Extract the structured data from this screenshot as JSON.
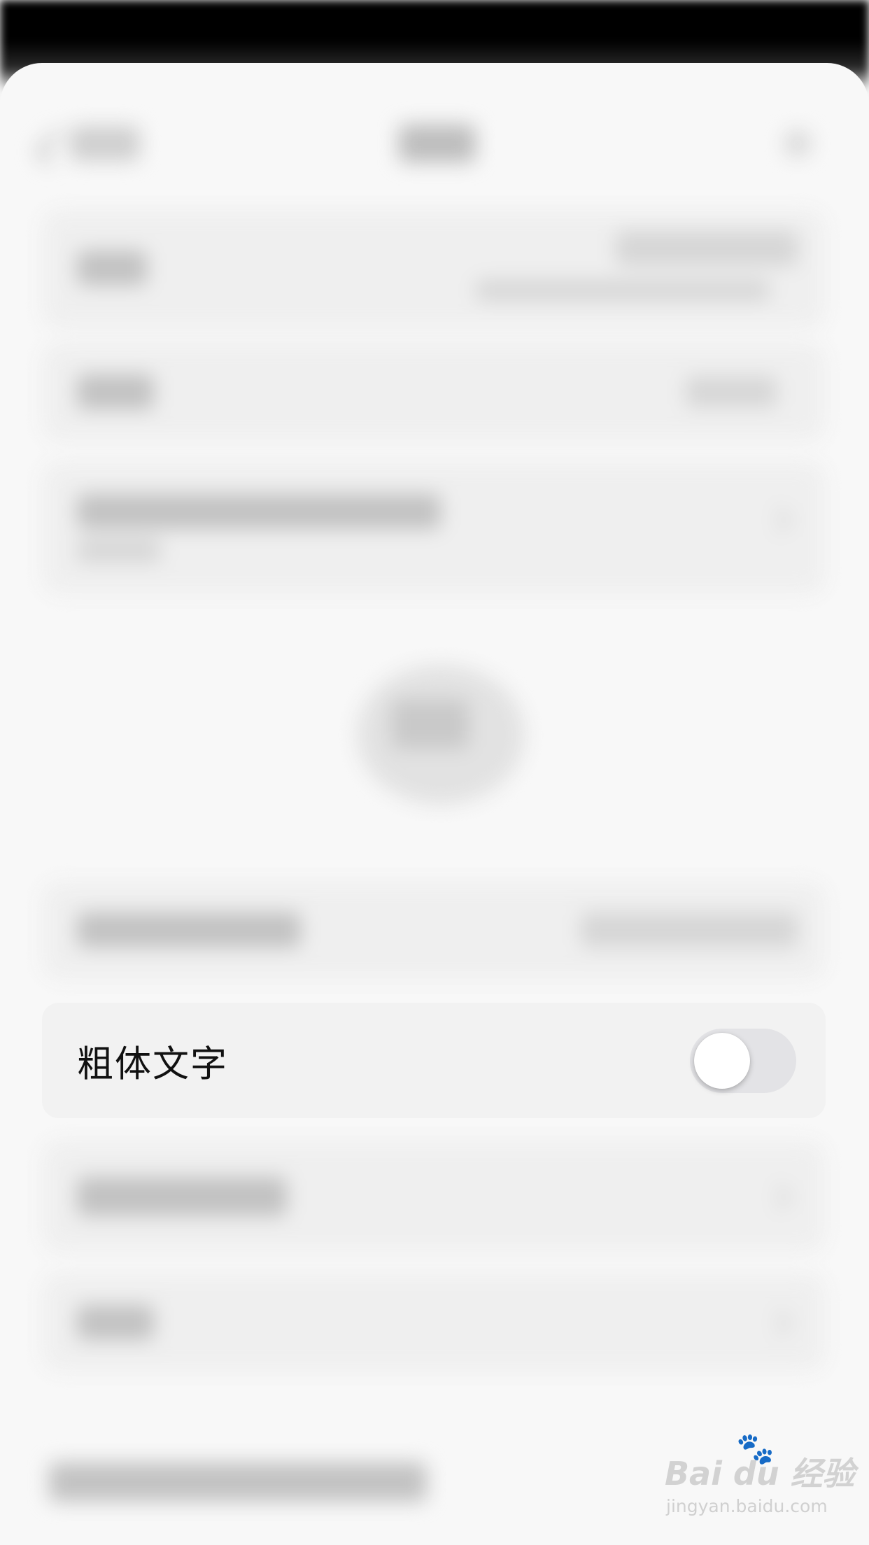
{
  "setting": {
    "label": "粗体文字",
    "toggle_on": false
  },
  "watermark": {
    "logo": "Bai du 经验",
    "url": "jingyan.baidu.com"
  },
  "colors": {
    "background": "#f7f7f7",
    "toggle_off": "#e3e3e6",
    "knob": "#ffffff",
    "label_text": "#111111"
  }
}
